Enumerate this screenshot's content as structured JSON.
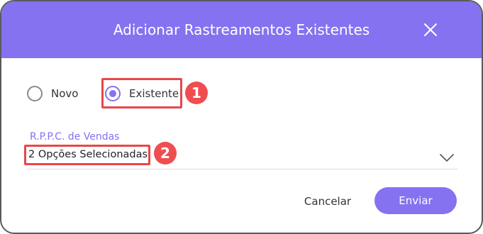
{
  "dialog": {
    "title": "Adicionar Rastreamentos Existentes",
    "close_icon": "close-icon"
  },
  "radio_options": [
    {
      "label": "Novo",
      "checked": false
    },
    {
      "label": "Existente",
      "checked": true
    }
  ],
  "field": {
    "label": "R.P.P.C. de Vendas",
    "value": "2 Opções Selecionadas",
    "icon": "chevron-down-icon"
  },
  "annotations": {
    "step1": "1",
    "step2": "2"
  },
  "buttons": {
    "cancel": "Cancelar",
    "submit": "Enviar"
  },
  "colors": {
    "accent": "#8472f0",
    "annotation_red": "#e8474a"
  }
}
